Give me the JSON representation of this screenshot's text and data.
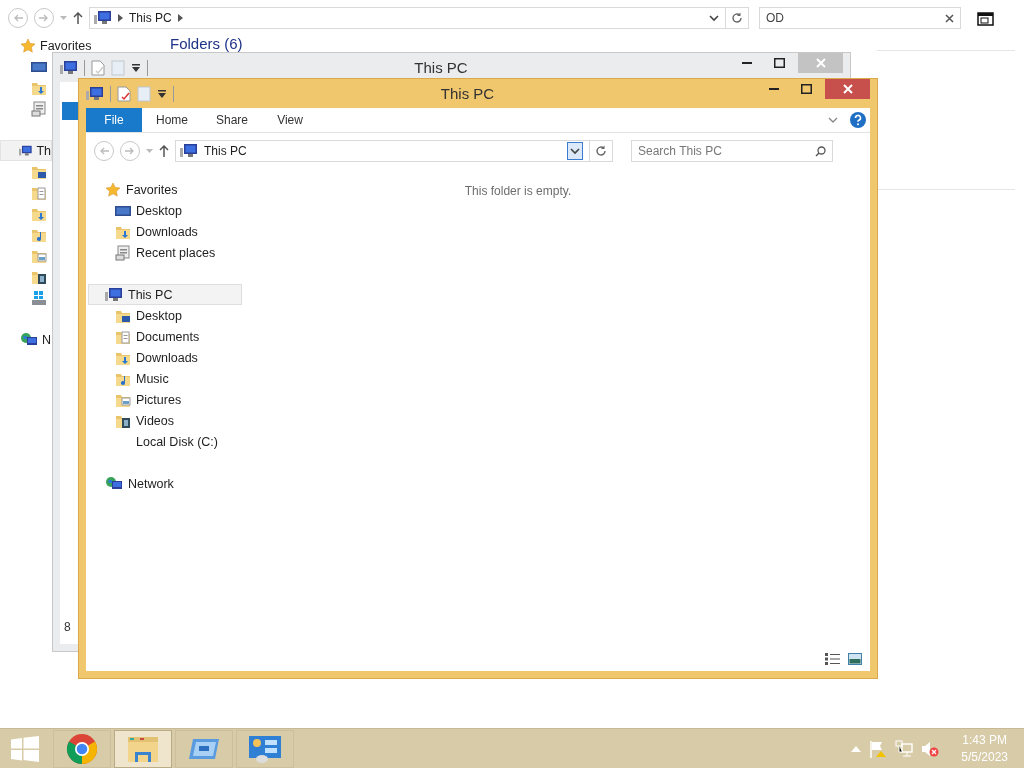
{
  "background_window": {
    "address_path": "This PC",
    "search_value": "OD",
    "section_heading": "Folders (6)",
    "nav": [
      {
        "label": "Favorites",
        "kind": "star",
        "selected": false,
        "children": [
          {
            "kind": "desktop"
          },
          {
            "kind": "downloads"
          },
          {
            "kind": "recent"
          }
        ]
      },
      {
        "label": "Th",
        "kind": "pc",
        "selected": true,
        "children": [
          {
            "kind": "folder-desktop"
          },
          {
            "kind": "documents"
          },
          {
            "kind": "downloads"
          },
          {
            "kind": "music"
          },
          {
            "kind": "pictures"
          },
          {
            "kind": "videos"
          },
          {
            "kind": "os-drive"
          }
        ]
      },
      {
        "label": "N",
        "kind": "network",
        "selected": false
      }
    ]
  },
  "middle_window": {
    "title": "This PC",
    "status": "8"
  },
  "front_window": {
    "title": "This PC",
    "tabs": [
      {
        "label": "File",
        "selected": true
      },
      {
        "label": "Home",
        "selected": false
      },
      {
        "label": "Share",
        "selected": false
      },
      {
        "label": "View",
        "selected": false
      }
    ],
    "address_path": "This PC",
    "search": {
      "placeholder": "Search This PC"
    },
    "nav": [
      {
        "label": "Favorites",
        "kind": "star",
        "selected": false,
        "children": [
          {
            "label": "Desktop",
            "kind": "desktop",
            "selected": false
          },
          {
            "label": "Downloads",
            "kind": "downloads",
            "selected": false
          },
          {
            "label": "Recent places",
            "kind": "recent",
            "selected": false
          }
        ]
      },
      {
        "label": "This PC",
        "kind": "pc",
        "selected": true,
        "children": [
          {
            "label": "Desktop",
            "kind": "folder-desktop",
            "selected": false
          },
          {
            "label": "Documents",
            "kind": "documents",
            "selected": false
          },
          {
            "label": "Downloads",
            "kind": "downloads",
            "selected": false
          },
          {
            "label": "Music",
            "kind": "music",
            "selected": false
          },
          {
            "label": "Pictures",
            "kind": "pictures",
            "selected": false
          },
          {
            "label": "Videos",
            "kind": "videos",
            "selected": false
          },
          {
            "label": "Local Disk (C:)",
            "kind": "blank",
            "selected": false
          }
        ]
      },
      {
        "label": "Network",
        "kind": "network",
        "selected": false
      }
    ],
    "empty_message": "This folder is empty."
  },
  "taskbar": {
    "apps": [
      {
        "kind": "start",
        "active": false
      },
      {
        "kind": "chrome",
        "active": false
      },
      {
        "kind": "explorer",
        "active": true
      },
      {
        "kind": "window",
        "active": false
      },
      {
        "kind": "control-panel",
        "active": false
      }
    ],
    "tray": [
      {
        "kind": "arrow"
      },
      {
        "kind": "flag"
      },
      {
        "kind": "network"
      },
      {
        "kind": "muted"
      }
    ],
    "time": "1:43 PM",
    "date": "5/5/2023"
  }
}
